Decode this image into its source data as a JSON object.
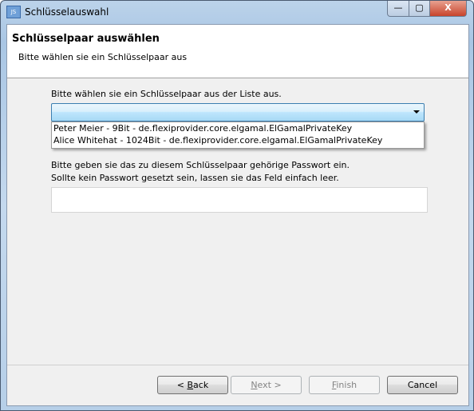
{
  "window": {
    "title": "Schlüsselauswahl",
    "icon": "java-app-icon",
    "controls": {
      "minimize": "—",
      "maximize": "▢",
      "close": "X"
    }
  },
  "header": {
    "title": "Schlüsselpaar auswählen",
    "subtitle": "Bitte wählen sie ein Schlüsselpaar aus"
  },
  "main": {
    "list_label": "Bitte wählen sie ein Schlüsselpaar aus der Liste aus.",
    "combo_value": "",
    "options": [
      "Peter Meier - 9Bit - de.flexiprovider.core.elgamal.ElGamalPrivateKey",
      "Alice Whitehat - 1024Bit - de.flexiprovider.core.elgamal.ElGamalPrivateKey"
    ],
    "password_label_1": "Bitte geben sie das zu diesem Schlüsselpaar gehörige Passwort ein.",
    "password_label_2": "Sollte kein Passwort gesetzt sein, lassen sie das Feld einfach leer.",
    "password_value": ""
  },
  "buttons": {
    "back": {
      "prefix": "< ",
      "mnemonic": "B",
      "rest": "ack",
      "enabled": true
    },
    "next": {
      "prefix": "",
      "mnemonic": "N",
      "rest": "ext >",
      "enabled": false
    },
    "finish": {
      "prefix": "",
      "mnemonic": "F",
      "rest": "inish",
      "enabled": false
    },
    "cancel": {
      "label": "Cancel",
      "enabled": true
    }
  }
}
